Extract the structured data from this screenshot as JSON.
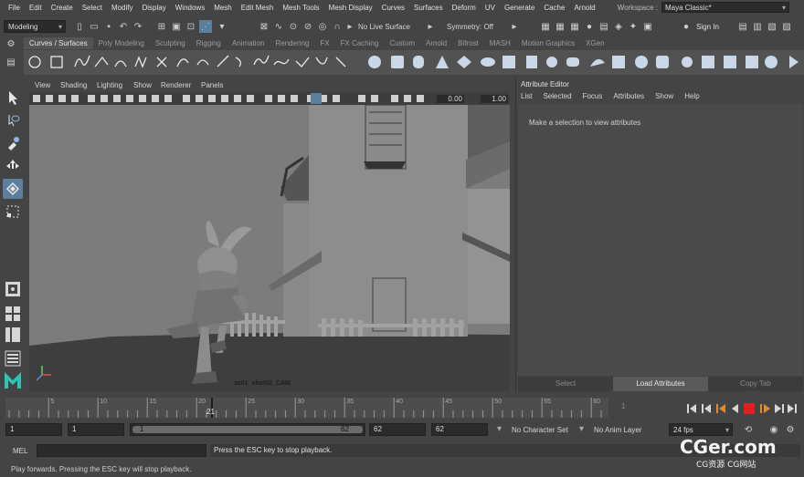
{
  "menus": [
    "File",
    "Edit",
    "Create",
    "Select",
    "Modify",
    "Display",
    "Windows",
    "Mesh",
    "Edit Mesh",
    "Mesh Tools",
    "Mesh Display",
    "Curves",
    "Surfaces",
    "Deform",
    "UV",
    "Generate",
    "Cache",
    "Arnold"
  ],
  "workspace": {
    "label": "Workspace :",
    "value": "Maya Classic*"
  },
  "status_line": {
    "mode": "Modeling",
    "live_surface": "No Live Surface",
    "symmetry": "Symmetry: Off",
    "sign_in": "Sign In"
  },
  "shelf_tabs": [
    "Curves / Surfaces",
    "Poly Modeling",
    "Sculpting",
    "Rigging",
    "Animation",
    "Rendering",
    "FX",
    "FX Caching",
    "Custom",
    "Arnold",
    "Bifrost",
    "MASH",
    "Motion Graphics",
    "XGen"
  ],
  "viewport": {
    "menus": [
      "View",
      "Shading",
      "Lighting",
      "Show",
      "Renderer",
      "Panels"
    ],
    "value_a": "0.00",
    "value_b": "1.00",
    "camera_label": "sc01_shot02_CAM"
  },
  "attribute_editor": {
    "title": "Attribute Editor",
    "menus": [
      "List",
      "Selected",
      "Focus",
      "Attributes",
      "Show",
      "Help"
    ],
    "hint": "Make a selection to view attributes",
    "buttons": [
      "Select",
      "Load Attributes",
      "Copy Tab"
    ]
  },
  "time_slider": {
    "ticks": [
      "5",
      "10",
      "15",
      "20",
      "25",
      "30",
      "35",
      "40",
      "45",
      "50",
      "55",
      "60"
    ],
    "current_frame": "21",
    "current_field": "1"
  },
  "range": {
    "start": "1",
    "inner_start": "1",
    "slider_start": "1",
    "slider_end": "62",
    "inner_end": "62",
    "end": "62",
    "character_set": "No Character Set",
    "anim_layer": "No Anim Layer",
    "fps": "24 fps"
  },
  "command_line": {
    "label": "MEL",
    "feedback": "Press the ESC key to stop playback."
  },
  "help_line": "Play forwards. Pressing the ESC key will stop playback.",
  "watermark": {
    "main": "CGer.com",
    "sub": "CG资源 CG网站"
  },
  "colors": {
    "accent_play": "#e02020",
    "selected_tool": "#5c7f9e"
  }
}
